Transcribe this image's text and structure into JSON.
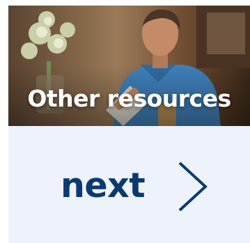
{
  "card": {
    "title": "Other resources",
    "image_alt": "man-using-tablet-photo"
  },
  "navigation": {
    "next_label": "next",
    "next_icon": "chevron-right-icon"
  },
  "colors": {
    "card_background": "#eef2fb",
    "accent_text": "#0b3a6f",
    "title_text": "#ffffff"
  }
}
